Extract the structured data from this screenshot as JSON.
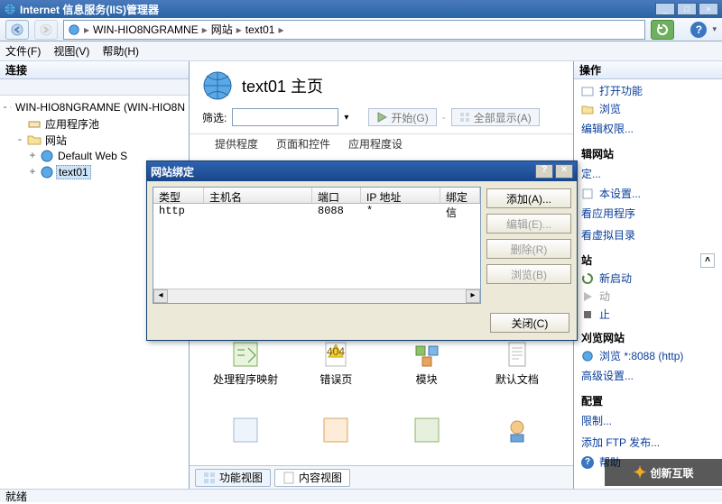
{
  "window": {
    "title": "Internet 信息服务(IIS)管理器",
    "min": "_",
    "max": "□",
    "close": "×",
    "nav": {
      "host": "WIN-HIO8NGRAMNE",
      "l2": "网站",
      "l3": "text01"
    }
  },
  "menu": {
    "file": "文件(F)",
    "view": "视图(V)",
    "help": "帮助(H)"
  },
  "left": {
    "header": "连接",
    "root": "WIN-HIO8NGRAMNE (WIN-HIO8N",
    "apppools": "应用程序池",
    "sites": "网站",
    "site1": "Default Web S",
    "site2": "text01"
  },
  "center": {
    "title": "text01 主页",
    "filter_label": "筛选:",
    "start_label": "开始(G)",
    "showall_label": "全部显示(A)",
    "row1": {
      "a": "提供程度",
      "b": "页面和控件",
      "c": "应用程度设"
    },
    "items": [
      {
        "label": "处理程序映射"
      },
      {
        "label": "错误页"
      },
      {
        "label": "模块"
      },
      {
        "label": "默认文档"
      }
    ],
    "view_features": "功能视图",
    "view_content": "内容视图"
  },
  "right": {
    "header": "操作",
    "open_feature": "打开功能",
    "browse": "浏览",
    "edit_perm": "编辑权限...",
    "sect_site": "辑网站",
    "bind": "定...",
    "basic": "本设置...",
    "viewapps": "看应用程序",
    "viewvdir": "看虚拟目录",
    "sect_manage": "站",
    "restart": "新启动",
    "start": "动",
    "stop": "止",
    "sect_browse": "刈览网站",
    "browse_8088": "浏览 *:8088 (http)",
    "advanced": "高级设置...",
    "sect_config": "配置",
    "limits": "限制...",
    "add_ftp": "添加 FTP 发布...",
    "help": "帮助"
  },
  "dialog": {
    "title": "网站绑定",
    "help": "?",
    "close": "×",
    "cols": {
      "type": "类型",
      "host": "主机名",
      "port": "端口",
      "ip": "IP 地址",
      "bind": "绑定信"
    },
    "row": {
      "type": "http",
      "host": "",
      "port": "8088",
      "ip": "*",
      "bind": ""
    },
    "btn_add": "添加(A)...",
    "btn_edit": "编辑(E)...",
    "btn_del": "删除(R)",
    "btn_browse": "浏览(B)",
    "btn_close": "关闭(C)"
  },
  "status": "就绪",
  "watermark": "创新互联"
}
